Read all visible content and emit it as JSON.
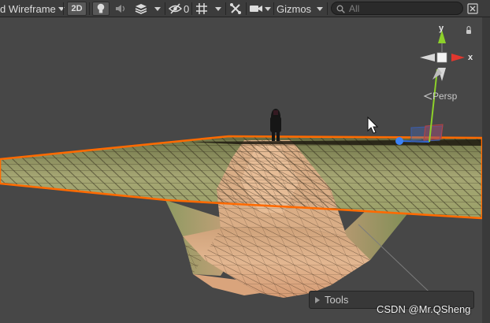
{
  "toolbar": {
    "shading_mode": "d Wireframe",
    "toggle_2d": "2D",
    "hidden_count": "0",
    "gizmos_label": "Gizmos",
    "search_placeholder": "All"
  },
  "scene": {
    "axis_y": "y",
    "axis_x": "x",
    "projection": "Persp",
    "tools_label": "Tools"
  },
  "watermark": "CSDN @Mr.QSheng",
  "colors": {
    "selection_outline": "#ff6a00",
    "terrain_light": "#e0b38f",
    "terrain_mid": "#a8a06a",
    "terrain_grass": "#8a9460",
    "background": "#474747",
    "axis_x": "#e0372e",
    "axis_y": "#8dd12a",
    "axis_z": "#3f78d8"
  }
}
